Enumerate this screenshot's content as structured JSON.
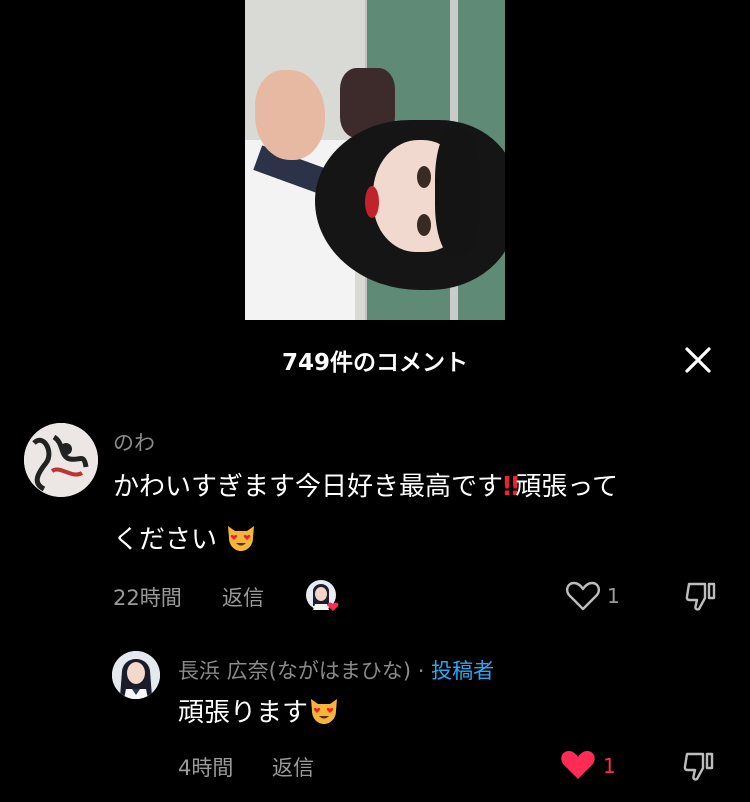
{
  "header": {
    "title": "749件のコメント",
    "close_icon": "close-icon"
  },
  "comments": [
    {
      "username": "のわ",
      "text_part1": "かわいすぎます今日好き最高です",
      "text_bang": "‼",
      "text_part2": "頑張って",
      "text_line2": "ください",
      "emoji": "heart-eyes-cat-emoji",
      "time": "22時間",
      "reply_label": "返信",
      "creator_liked": true,
      "like_count": "1",
      "liked": false,
      "reply": {
        "username": "長浜 広奈(ながはまひな)",
        "separator": "·",
        "creator_badge": "投稿者",
        "text": "頑張ります",
        "emoji": "heart-eyes-cat-emoji",
        "time": "4時間",
        "reply_label": "返信",
        "like_count": "1",
        "liked": true
      }
    }
  ],
  "colors": {
    "background": "#000000",
    "creator_badge": "#2aa7f1",
    "liked_heart": "#fe2c55"
  }
}
